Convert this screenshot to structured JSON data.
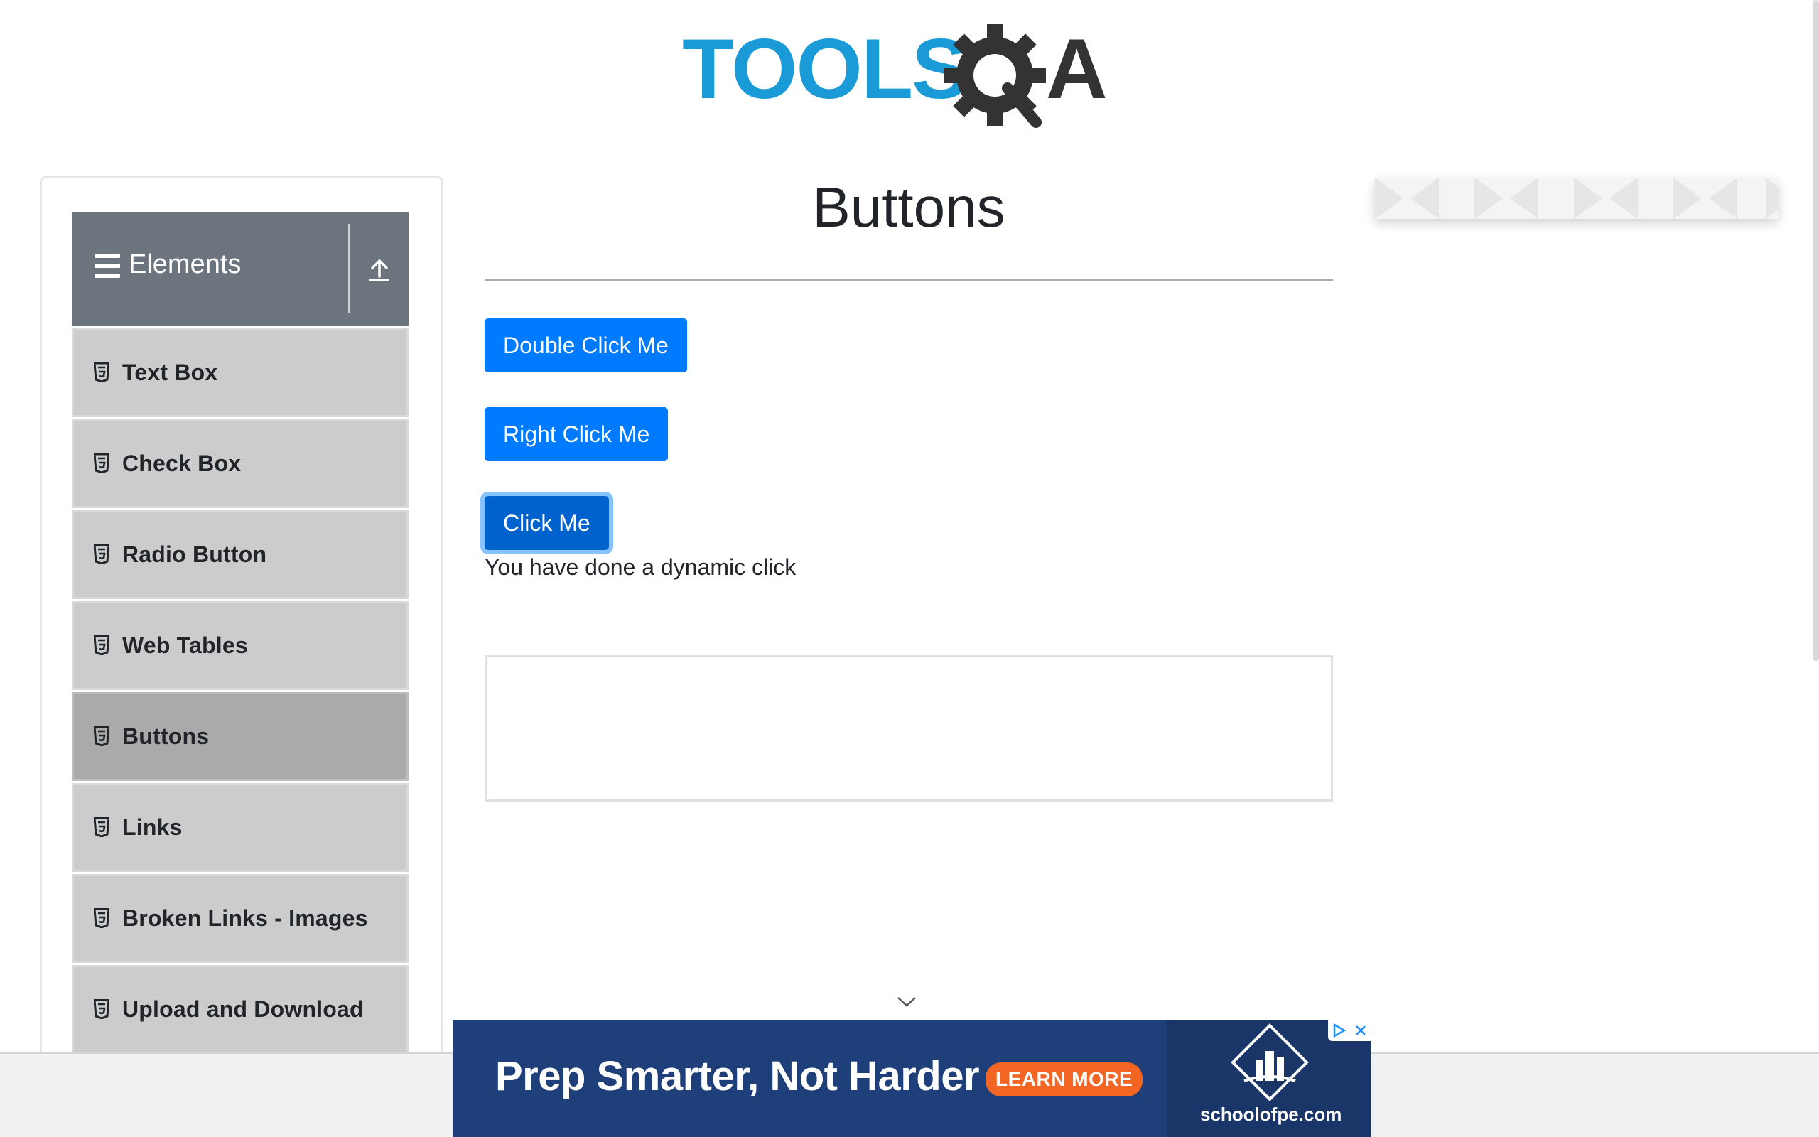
{
  "logo": {
    "text_tools": "TOOLS",
    "text_qa": "A"
  },
  "sidebar": {
    "group_title": "Elements",
    "items": [
      {
        "label": "Text Box",
        "active": false
      },
      {
        "label": "Check Box",
        "active": false
      },
      {
        "label": "Radio Button",
        "active": false
      },
      {
        "label": "Web Tables",
        "active": false
      },
      {
        "label": "Buttons",
        "active": true
      },
      {
        "label": "Links",
        "active": false
      },
      {
        "label": "Broken Links - Images",
        "active": false
      },
      {
        "label": "Upload and Download",
        "active": false
      }
    ]
  },
  "main": {
    "title": "Buttons",
    "double_click_label": "Double Click Me",
    "right_click_label": "Right Click Me",
    "click_label": "Click Me",
    "result_message": "You have done a dynamic click"
  },
  "banner": {
    "headline": "Prep Smarter, Not Harder",
    "cta": "LEARN MORE",
    "brand": "schoolofpe.com"
  },
  "colors": {
    "primary": "#007bff",
    "sidebar_header": "#6c757d",
    "menu_item": "#cccccc",
    "menu_item_active": "#aaaaaa",
    "logo_blue": "#1a9bd7",
    "logo_dark": "#333333"
  }
}
